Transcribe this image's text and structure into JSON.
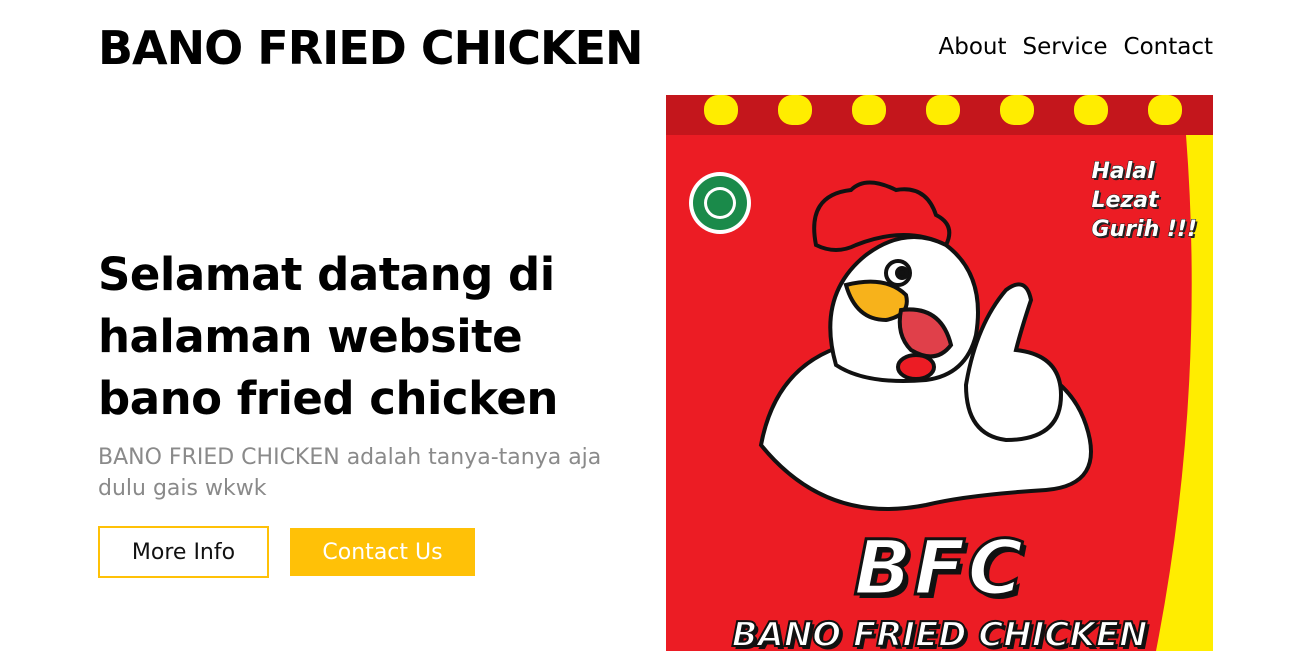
{
  "header": {
    "brand": "BANO FRIED CHICKEN",
    "nav": [
      {
        "label": "About"
      },
      {
        "label": "Service"
      },
      {
        "label": "Contact"
      }
    ]
  },
  "hero": {
    "title": "Selamat datang di halaman website bano fried chicken",
    "subtitle": "BANO FRIED CHICKEN adalah tanya-tanya aja dulu gais wkwk",
    "buttons": {
      "more_info": "More Info",
      "contact_us": "Contact Us"
    }
  },
  "poster": {
    "slogan_lines": [
      "Halal",
      "Lezat",
      "Gurih !!!"
    ],
    "halal_badge": "HALAL",
    "logo": "BFC",
    "name": "BANO FRIED CHICKEN"
  },
  "colors": {
    "accent": "#ffc107",
    "poster_red": "#ec1c24",
    "poster_yellow": "#ffed00",
    "halal_green": "#1a8a4a"
  }
}
